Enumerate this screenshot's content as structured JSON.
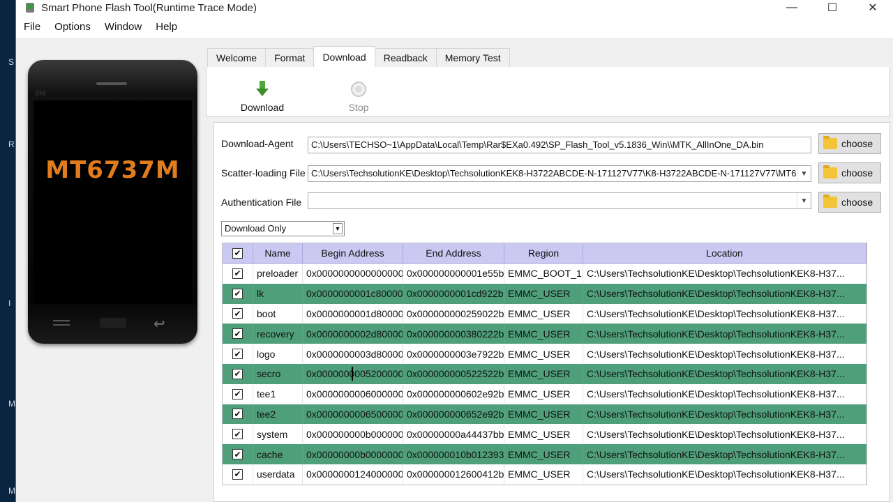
{
  "window": {
    "title": "Smart Phone Flash Tool(Runtime Trace Mode)",
    "controls": [
      "—",
      "☐",
      "✕"
    ]
  },
  "menu": [
    "File",
    "Options",
    "Window",
    "Help"
  ],
  "phone": {
    "brand": "BM",
    "chip": "MT6737M"
  },
  "tabs": [
    {
      "label": "Welcome",
      "active": false
    },
    {
      "label": "Format",
      "active": false
    },
    {
      "label": "Download",
      "active": true
    },
    {
      "label": "Readback",
      "active": false
    },
    {
      "label": "Memory Test",
      "active": false
    }
  ],
  "toolbar": {
    "download_label": "Download",
    "stop_label": "Stop"
  },
  "form": {
    "download_agent": {
      "label": "Download-Agent",
      "value": "C:\\Users\\TECHSO~1\\AppData\\Local\\Temp\\Rar$EXa0.492\\SP_Flash_Tool_v5.1836_Win\\\\MTK_AllInOne_DA.bin",
      "button": "choose"
    },
    "scatter_file": {
      "label": "Scatter-loading File",
      "value": "C:\\Users\\TechsolutionKE\\Desktop\\TechsolutionKEK8-H3722ABCDE-N-171127V77\\K8-H3722ABCDE-N-171127V77\\MT6",
      "button": "choose"
    },
    "auth_file": {
      "label": "Authentication File",
      "value": "",
      "button": "choose"
    },
    "mode": "Download Only"
  },
  "table": {
    "columns": [
      "Name",
      "Begin Address",
      "End Address",
      "Region",
      "Location"
    ],
    "rows": [
      {
        "checked": true,
        "name": "preloader",
        "begin": "0x0000000000000000",
        "end": "0x000000000001e55b",
        "region": "EMMC_BOOT_1",
        "location": "C:\\Users\\TechsolutionKE\\Desktop\\TechsolutionKEK8-H37..."
      },
      {
        "checked": true,
        "name": "lk",
        "begin": "0x0000000001c80000",
        "end": "0x0000000001cd922b",
        "region": "EMMC_USER",
        "location": "C:\\Users\\TechsolutionKE\\Desktop\\TechsolutionKEK8-H37..."
      },
      {
        "checked": true,
        "name": "boot",
        "begin": "0x0000000001d80000",
        "end": "0x000000000259022b",
        "region": "EMMC_USER",
        "location": "C:\\Users\\TechsolutionKE\\Desktop\\TechsolutionKEK8-H37..."
      },
      {
        "checked": true,
        "name": "recovery",
        "begin": "0x0000000002d80000",
        "end": "0x000000000380222b",
        "region": "EMMC_USER",
        "location": "C:\\Users\\TechsolutionKE\\Desktop\\TechsolutionKEK8-H37..."
      },
      {
        "checked": true,
        "name": "logo",
        "begin": "0x0000000003d80000",
        "end": "0x0000000003e7922b",
        "region": "EMMC_USER",
        "location": "C:\\Users\\TechsolutionKE\\Desktop\\TechsolutionKEK8-H37..."
      },
      {
        "checked": true,
        "name": "secro",
        "begin": "0x0000000005200000",
        "end": "0x000000000522522b",
        "region": "EMMC_USER",
        "location": "C:\\Users\\TechsolutionKE\\Desktop\\TechsolutionKEK8-H37..."
      },
      {
        "checked": true,
        "name": "tee1",
        "begin": "0x0000000006000000",
        "end": "0x000000000602e92b",
        "region": "EMMC_USER",
        "location": "C:\\Users\\TechsolutionKE\\Desktop\\TechsolutionKEK8-H37..."
      },
      {
        "checked": true,
        "name": "tee2",
        "begin": "0x0000000006500000",
        "end": "0x000000000652e92b",
        "region": "EMMC_USER",
        "location": "C:\\Users\\TechsolutionKE\\Desktop\\TechsolutionKEK8-H37..."
      },
      {
        "checked": true,
        "name": "system",
        "begin": "0x000000000b000000",
        "end": "0x00000000a44437bb",
        "region": "EMMC_USER",
        "location": "C:\\Users\\TechsolutionKE\\Desktop\\TechsolutionKEK8-H37..."
      },
      {
        "checked": true,
        "name": "cache",
        "begin": "0x00000000b0000000",
        "end": "0x000000010b012393",
        "region": "EMMC_USER",
        "location": "C:\\Users\\TechsolutionKE\\Desktop\\TechsolutionKEK8-H37..."
      },
      {
        "checked": true,
        "name": "userdata",
        "begin": "0x0000000124000000",
        "end": "0x000000012600412b",
        "region": "EMMC_USER",
        "location": "C:\\Users\\TechsolutionKE\\Desktop\\TechsolutionKEK8-H37..."
      }
    ]
  },
  "colors": {
    "header_bg": "#cbc9f2",
    "alt_row": "#4fa07a",
    "chip_text": "#e07c1e"
  }
}
